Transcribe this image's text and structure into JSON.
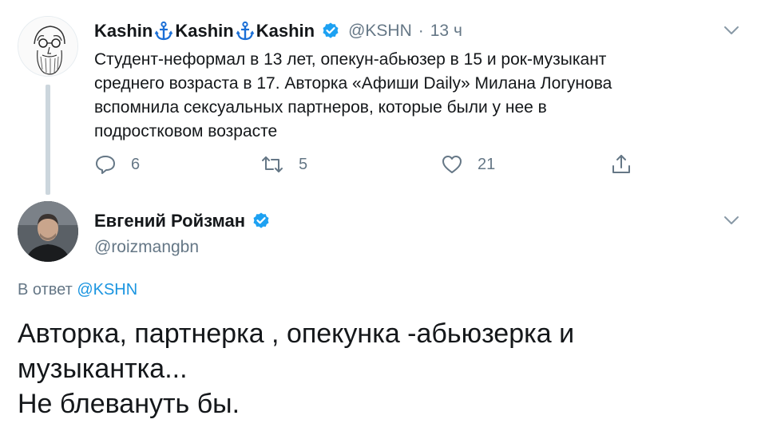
{
  "tweet1": {
    "author": {
      "name_parts": [
        "Kashin",
        "Kashin",
        "Kashin"
      ],
      "handle": "@KSHN",
      "separator": "·",
      "time": "13 ч"
    },
    "text_lines": [
      "Студент-неформал в 13 лет, опекун-абьюзер в 15 и рок-музыкант",
      "среднего возраста в 17. Авторка «Афиши Daily» Милана Логунова",
      "вспомнила сексуальных партнеров, которые были у нее в",
      "подростковом возрасте"
    ],
    "actions": {
      "replies": "6",
      "retweets": "5",
      "likes": "21"
    }
  },
  "tweet2": {
    "author": {
      "name": "Евгений Ройзман",
      "handle": "@roizmangbn"
    },
    "reply_to": {
      "prefix": "В ответ",
      "handle": "@KSHN"
    },
    "text_lines": [
      "Авторка, партнерка , опекунка -абьюзерка и",
      "музыкантка...",
      "Не блевануть бы."
    ]
  },
  "colors": {
    "accent": "#1da1f2",
    "secondary_text": "#657786",
    "link": "#1b95e0"
  },
  "icons": [
    "anchor-icon",
    "verified-icon",
    "chevron-down-icon",
    "reply-icon",
    "retweet-icon",
    "like-icon",
    "share-icon"
  ]
}
